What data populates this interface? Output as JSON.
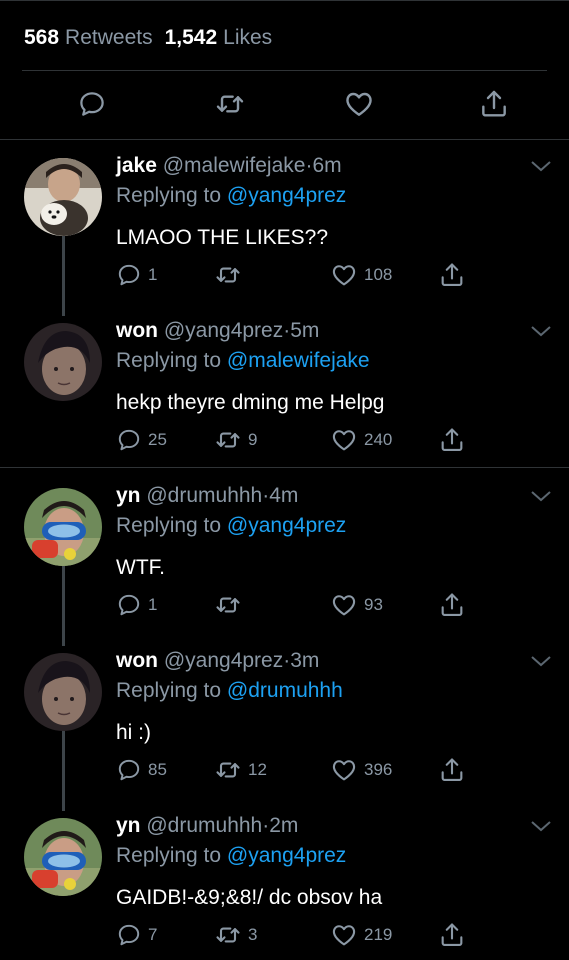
{
  "stats": {
    "retweets_count": "568",
    "retweets_label": "Retweets",
    "likes_count": "1,542",
    "likes_label": "Likes"
  },
  "action_bar": {
    "icons": [
      "reply-icon",
      "retweet-icon",
      "like-icon",
      "share-icon"
    ]
  },
  "tweets": [
    {
      "name": "jake",
      "handle": "@malewifejake",
      "dot": "·",
      "time": "6m",
      "reply_prefix": "Replying to",
      "reply_to": "@yang4prez",
      "text": "LMAOO THE LIKES??",
      "replies": "1",
      "retweets": "",
      "likes": "108"
    },
    {
      "name": "won",
      "handle": "@yang4prez",
      "dot": "·",
      "time": "5m",
      "reply_prefix": "Replying to",
      "reply_to": "@malewifejake",
      "text": "hekp theyre dming me Helpg",
      "replies": "25",
      "retweets": "9",
      "likes": "240"
    },
    {
      "name": "yn",
      "handle": "@drumuhhh",
      "dot": "·",
      "time": "4m",
      "reply_prefix": "Replying to",
      "reply_to": "@yang4prez",
      "text": "WTF.",
      "replies": "1",
      "retweets": "",
      "likes": "93"
    },
    {
      "name": "won",
      "handle": "@yang4prez",
      "dot": "·",
      "time": "3m",
      "reply_prefix": "Replying to",
      "reply_to": "@drumuhhh",
      "text": "hi :)",
      "replies": "85",
      "retweets": "12",
      "likes": "396"
    },
    {
      "name": "yn",
      "handle": "@drumuhhh",
      "dot": "·",
      "time": "2m",
      "reply_prefix": "Replying to",
      "reply_to": "@yang4prez",
      "text": "GAIDB!-&9;&8!/ dc obsov ha",
      "replies": "7",
      "retweets": "3",
      "likes": "219"
    }
  ],
  "colors": {
    "background": "#000000",
    "secondary_text": "#8b98a5",
    "mention": "#1da1f2",
    "divider": "#2f3336"
  }
}
